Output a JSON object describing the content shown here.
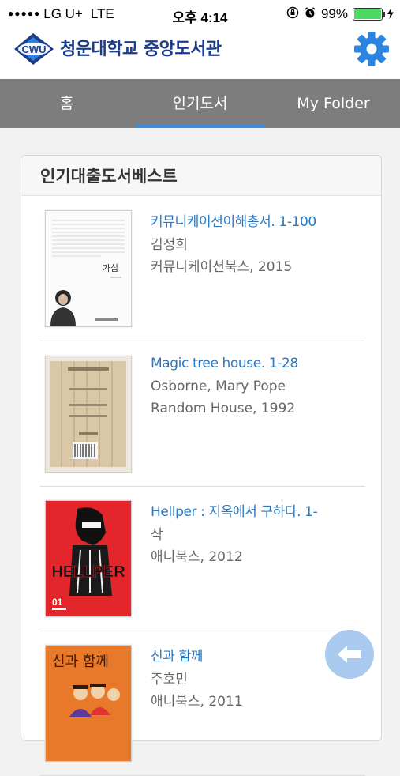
{
  "status_bar": {
    "dots": "●●●●●",
    "carrier": "LG U+",
    "network": "LTE",
    "time": "오후 4:14",
    "battery": "99%",
    "battery_level": 0.99,
    "icons": [
      "orientation-lock-icon",
      "alarm-icon",
      "battery-icon",
      "charging-bolt-icon"
    ]
  },
  "header": {
    "logo_text": "CWU",
    "title": "청운대학교 중앙도서관",
    "settings_icon": "gear-icon",
    "brand_color": "#1c3c8c",
    "accent_color": "#2a84e0"
  },
  "tabs": [
    {
      "label": "홈",
      "active": false
    },
    {
      "label": "인기도서",
      "active": true
    },
    {
      "label": "My Folder",
      "active": false
    }
  ],
  "panel": {
    "title": "인기대출도서베스트",
    "books": [
      {
        "title": "커뮤니케이션이해총서. 1-100",
        "author": "김정희",
        "publisher": "커뮤니케이션북스, 2015",
        "cover_text": "가십"
      },
      {
        "title": "Magic tree house. 1-28",
        "author": "Osborne, Mary Pope",
        "publisher": "Random House, 1992"
      },
      {
        "title": "Hellper : 지옥에서 구하다. 1-",
        "author": "삭",
        "publisher": "애니북스, 2012",
        "cover_text": "HELLPER",
        "cover_volume": "01"
      },
      {
        "title": "신과 함께",
        "author": "주호민",
        "publisher": "애니북스, 2011",
        "cover_text": "신과 함께"
      }
    ]
  },
  "back_button_icon": "arrow-left-icon"
}
